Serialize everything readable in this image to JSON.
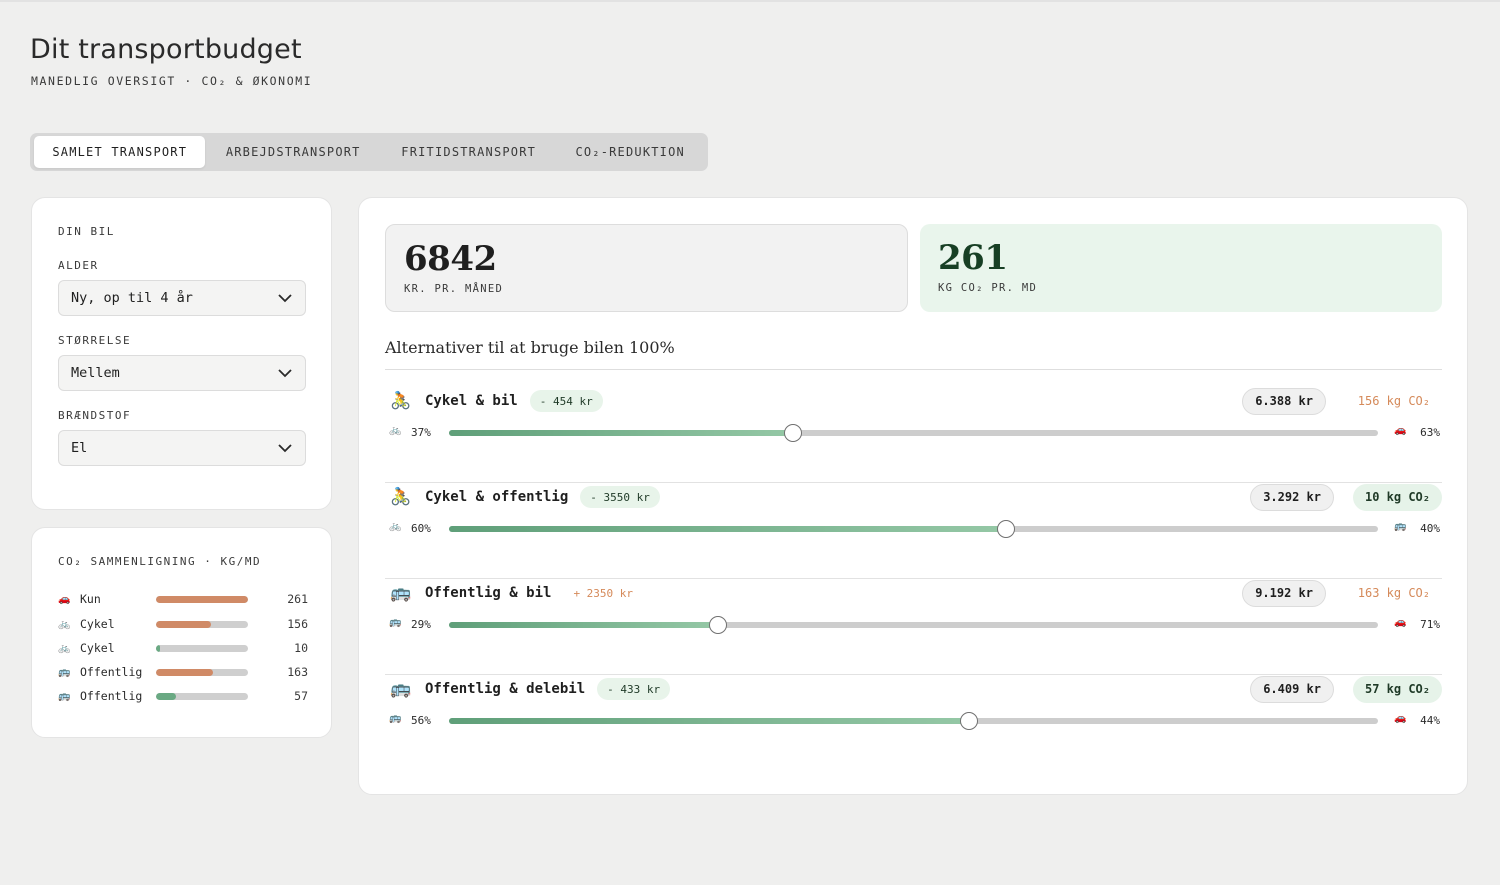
{
  "header": {
    "title": "Dit transportbudget",
    "subtitle": "MANEDLIG OVERSIGT · CO₂ & ØKONOMI"
  },
  "tabs": [
    {
      "label": "SAMLET TRANSPORT",
      "active": true
    },
    {
      "label": "ARBEJDSTRANSPORT",
      "active": false
    },
    {
      "label": "FRITIDSTRANSPORT",
      "active": false
    },
    {
      "label": "CO₂-REDUKTION",
      "active": false
    }
  ],
  "car": {
    "heading": "DIN BIL",
    "age_label": "ALDER",
    "age_value": "Ny, op til 4 år",
    "size_label": "STØRRELSE",
    "size_value": "Mellem",
    "fuel_label": "BRÆNDSTOF",
    "fuel_value": "El"
  },
  "comparison": {
    "heading": "CO₂ SAMMENLIGNING · KG/MD",
    "rows": [
      {
        "icon": "car-icon",
        "glyph": "🚗",
        "name": "Kun",
        "value": "261",
        "fill": 1.0,
        "color": "#d08a66"
      },
      {
        "icon": "bike-icon",
        "glyph": "🚲",
        "name": "Cykel",
        "value": "156",
        "fill": 0.6,
        "color": "#d08a66"
      },
      {
        "icon": "bike-icon",
        "glyph": "🚲",
        "name": "Cykel",
        "value": "10",
        "fill": 0.04,
        "color": "#6aa983"
      },
      {
        "icon": "bus-icon",
        "glyph": "🚌",
        "name": "Offentlig",
        "value": "163",
        "fill": 0.62,
        "color": "#d08a66"
      },
      {
        "icon": "bus-icon",
        "glyph": "🚌",
        "name": "Offentlig",
        "value": "57",
        "fill": 0.22,
        "color": "#6aa983"
      }
    ]
  },
  "stats": {
    "cost_value": "6842",
    "cost_label": "KR. PR. MÅNED",
    "co2_value": "261",
    "co2_label": "KG CO₂ PR. MD"
  },
  "alternatives": {
    "title": "Alternativer til at bruge bilen 100%",
    "rows": [
      {
        "icon": "cyclist-icon",
        "glyph": "🚴",
        "name": "Cykel & bil",
        "delta": "- 454 kr",
        "delta_good": true,
        "cost": "6.388 kr",
        "co2": "156 kg CO₂",
        "co2_good": false,
        "left_icon": "bike-icon",
        "left_glyph": "🚲",
        "left_pct": "37%",
        "right_icon": "car-icon",
        "right_glyph": "🚗",
        "right_pct": "63%",
        "split": 0.37
      },
      {
        "icon": "cyclist-icon",
        "glyph": "🚴",
        "name": "Cykel & offentlig",
        "delta": "- 3550 kr",
        "delta_good": true,
        "cost": "3.292 kr",
        "co2": "10 kg CO₂",
        "co2_good": true,
        "left_icon": "bike-icon",
        "left_glyph": "🚲",
        "left_pct": "60%",
        "right_icon": "bus-icon",
        "right_glyph": "🚌",
        "right_pct": "40%",
        "split": 0.6
      },
      {
        "icon": "bus-icon",
        "glyph": "🚌",
        "name": "Offentlig & bil",
        "delta": "+ 2350 kr",
        "delta_good": false,
        "cost": "9.192 kr",
        "co2": "163 kg CO₂",
        "co2_good": false,
        "left_icon": "bus-icon",
        "left_glyph": "🚌",
        "left_pct": "29%",
        "right_icon": "car-icon",
        "right_glyph": "🚗",
        "right_pct": "71%",
        "split": 0.29
      },
      {
        "icon": "bus-icon",
        "glyph": "🚌",
        "name": "Offentlig & delebil",
        "delta": "- 433 kr",
        "delta_good": true,
        "cost": "6.409 kr",
        "co2": "57 kg CO₂",
        "co2_good": true,
        "left_icon": "bus-icon",
        "left_glyph": "🚌",
        "left_pct": "56%",
        "right_icon": "car-icon",
        "right_glyph": "🚗",
        "right_pct": "44%",
        "split": 0.56
      }
    ]
  }
}
